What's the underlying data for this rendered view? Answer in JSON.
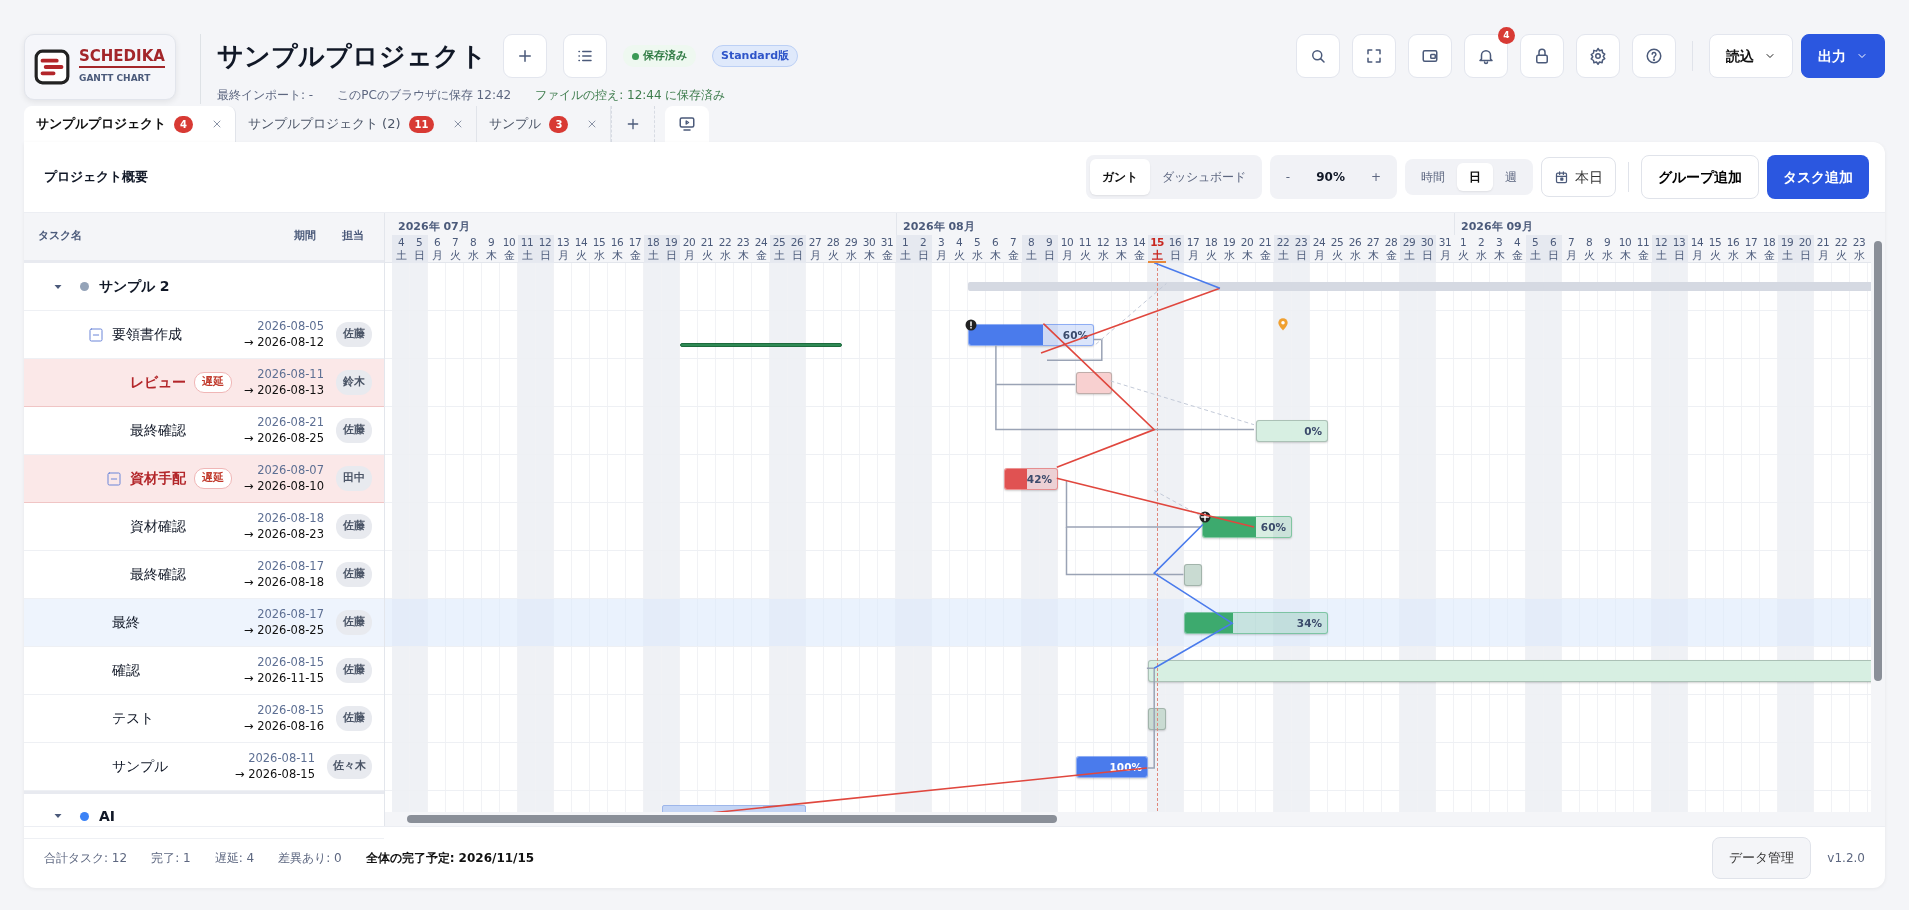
{
  "app": {
    "logo_title": "SCHEDIKA",
    "logo_subtitle": "GANTT CHART"
  },
  "project": {
    "title": "サンプルプロジェクト",
    "save_status": "保存済み",
    "edition": "Standard版"
  },
  "meta": [
    {
      "kind": "info",
      "text": "最終インポート: -"
    },
    {
      "kind": "info",
      "text": "このPCのブラウザに保存 12:42"
    },
    {
      "kind": "success",
      "text": "ファイルの控え: 12:44 に保存済み"
    }
  ],
  "toolbar_icons": [
    {
      "kind": "search"
    },
    {
      "kind": "fullscreen"
    },
    {
      "kind": "wallet"
    },
    {
      "kind": "bell",
      "badge": "4"
    },
    {
      "kind": "lock"
    },
    {
      "kind": "settings"
    },
    {
      "kind": "help"
    }
  ],
  "menus": [
    {
      "label": "読込",
      "primary": false
    },
    {
      "label": "出力",
      "primary": true
    }
  ],
  "tabs": [
    {
      "label": "サンプルプロジェクト",
      "count": "4",
      "selected": true
    },
    {
      "label": "サンプルプロジェクト (2)",
      "count": "11",
      "selected": false
    },
    {
      "label": "サンプル",
      "count": "3",
      "selected": false
    }
  ],
  "panel": {
    "title": "プロジェクト概要",
    "views": [
      {
        "label": "ガント",
        "selected": true
      },
      {
        "label": "ダッシュボード",
        "selected": false
      }
    ],
    "zoom": {
      "minus": "-",
      "value": "90%",
      "plus": "+"
    },
    "scales": [
      {
        "label": "時間",
        "selected": false
      },
      {
        "label": "日",
        "selected": true
      },
      {
        "label": "週",
        "selected": false
      }
    ],
    "today_button": "本日",
    "add_group": "グループ追加",
    "add_task": "タスク追加"
  },
  "columns": [
    "タスク名",
    "期間",
    "担当"
  ],
  "months": [
    {
      "label": "2026年 07月",
      "days": [
        {
          "day": "4",
          "weekday": "土",
          "weekend": true,
          "today": false
        },
        {
          "day": "5",
          "weekday": "日",
          "weekend": true,
          "today": false
        },
        {
          "day": "6",
          "weekday": "月",
          "weekend": false,
          "today": false
        },
        {
          "day": "7",
          "weekday": "火",
          "weekend": false,
          "today": false
        },
        {
          "day": "8",
          "weekday": "水",
          "weekend": false,
          "today": false
        },
        {
          "day": "9",
          "weekday": "木",
          "weekend": false,
          "today": false
        },
        {
          "day": "10",
          "weekday": "金",
          "weekend": false,
          "today": false
        },
        {
          "day": "11",
          "weekday": "土",
          "weekend": true,
          "today": false
        },
        {
          "day": "12",
          "weekday": "日",
          "weekend": true,
          "today": false
        },
        {
          "day": "13",
          "weekday": "月",
          "weekend": false,
          "today": false
        },
        {
          "day": "14",
          "weekday": "火",
          "weekend": false,
          "today": false
        },
        {
          "day": "15",
          "weekday": "水",
          "weekend": false,
          "today": false
        },
        {
          "day": "16",
          "weekday": "木",
          "weekend": false,
          "today": false
        },
        {
          "day": "17",
          "weekday": "金",
          "weekend": false,
          "today": false
        },
        {
          "day": "18",
          "weekday": "土",
          "weekend": true,
          "today": false
        },
        {
          "day": "19",
          "weekday": "日",
          "weekend": true,
          "today": false
        },
        {
          "day": "20",
          "weekday": "月",
          "weekend": false,
          "today": false
        },
        {
          "day": "21",
          "weekday": "火",
          "weekend": false,
          "today": false
        },
        {
          "day": "22",
          "weekday": "水",
          "weekend": false,
          "today": false
        },
        {
          "day": "23",
          "weekday": "木",
          "weekend": false,
          "today": false
        },
        {
          "day": "24",
          "weekday": "金",
          "weekend": false,
          "today": false
        },
        {
          "day": "25",
          "weekday": "土",
          "weekend": true,
          "today": false
        },
        {
          "day": "26",
          "weekday": "日",
          "weekend": true,
          "today": false
        },
        {
          "day": "27",
          "weekday": "月",
          "weekend": false,
          "today": false
        },
        {
          "day": "28",
          "weekday": "火",
          "weekend": false,
          "today": false
        },
        {
          "day": "29",
          "weekday": "水",
          "weekend": false,
          "today": false
        },
        {
          "day": "30",
          "weekday": "木",
          "weekend": false,
          "today": false
        },
        {
          "day": "31",
          "weekday": "金",
          "weekend": false,
          "today": false
        }
      ]
    },
    {
      "label": "2026年 08月",
      "days": [
        {
          "day": "1",
          "weekday": "土",
          "weekend": true,
          "today": false
        },
        {
          "day": "2",
          "weekday": "日",
          "weekend": true,
          "today": false
        },
        {
          "day": "3",
          "weekday": "月",
          "weekend": false,
          "today": false
        },
        {
          "day": "4",
          "weekday": "火",
          "weekend": false,
          "today": false
        },
        {
          "day": "5",
          "weekday": "水",
          "weekend": false,
          "today": false
        },
        {
          "day": "6",
          "weekday": "木",
          "weekend": false,
          "today": false
        },
        {
          "day": "7",
          "weekday": "金",
          "weekend": false,
          "today": false
        },
        {
          "day": "8",
          "weekday": "土",
          "weekend": true,
          "today": false
        },
        {
          "day": "9",
          "weekday": "日",
          "weekend": true,
          "today": false
        },
        {
          "day": "10",
          "weekday": "月",
          "weekend": false,
          "today": false
        },
        {
          "day": "11",
          "weekday": "火",
          "weekend": false,
          "today": false
        },
        {
          "day": "12",
          "weekday": "水",
          "weekend": false,
          "today": false
        },
        {
          "day": "13",
          "weekday": "木",
          "weekend": false,
          "today": false
        },
        {
          "day": "14",
          "weekday": "金",
          "weekend": false,
          "today": false
        },
        {
          "day": "15",
          "weekday": "土",
          "weekend": true,
          "today": true
        },
        {
          "day": "16",
          "weekday": "日",
          "weekend": true,
          "today": false
        },
        {
          "day": "17",
          "weekday": "月",
          "weekend": false,
          "today": false
        },
        {
          "day": "18",
          "weekday": "火",
          "weekend": false,
          "today": false
        },
        {
          "day": "19",
          "weekday": "水",
          "weekend": false,
          "today": false
        },
        {
          "day": "20",
          "weekday": "木",
          "weekend": false,
          "today": false
        },
        {
          "day": "21",
          "weekday": "金",
          "weekend": false,
          "today": false
        },
        {
          "day": "22",
          "weekday": "土",
          "weekend": true,
          "today": false
        },
        {
          "day": "23",
          "weekday": "日",
          "weekend": true,
          "today": false
        },
        {
          "day": "24",
          "weekday": "月",
          "weekend": false,
          "today": false
        },
        {
          "day": "25",
          "weekday": "火",
          "weekend": false,
          "today": false
        },
        {
          "day": "26",
          "weekday": "水",
          "weekend": false,
          "today": false
        },
        {
          "day": "27",
          "weekday": "木",
          "weekend": false,
          "today": false
        },
        {
          "day": "28",
          "weekday": "金",
          "weekend": false,
          "today": false
        },
        {
          "day": "29",
          "weekday": "土",
          "weekend": true,
          "today": false
        },
        {
          "day": "30",
          "weekday": "日",
          "weekend": true,
          "today": false
        },
        {
          "day": "31",
          "weekday": "月",
          "weekend": false,
          "today": false
        }
      ]
    },
    {
      "label": "2026年 09月",
      "days": [
        {
          "day": "1",
          "weekday": "火",
          "weekend": false,
          "today": false
        },
        {
          "day": "2",
          "weekday": "水",
          "weekend": false,
          "today": false
        },
        {
          "day": "3",
          "weekday": "木",
          "weekend": false,
          "today": false
        },
        {
          "day": "4",
          "weekday": "金",
          "weekend": false,
          "today": false
        },
        {
          "day": "5",
          "weekday": "土",
          "weekend": true,
          "today": false
        },
        {
          "day": "6",
          "weekday": "日",
          "weekend": true,
          "today": false
        },
        {
          "day": "7",
          "weekday": "月",
          "weekend": false,
          "today": false
        },
        {
          "day": "8",
          "weekday": "火",
          "weekend": false,
          "today": false
        },
        {
          "day": "9",
          "weekday": "水",
          "weekend": false,
          "today": false
        },
        {
          "day": "10",
          "weekday": "木",
          "weekend": false,
          "today": false
        },
        {
          "day": "11",
          "weekday": "金",
          "weekend": false,
          "today": false
        },
        {
          "day": "12",
          "weekday": "土",
          "weekend": true,
          "today": false
        },
        {
          "day": "13",
          "weekday": "日",
          "weekend": true,
          "today": false
        },
        {
          "day": "14",
          "weekday": "月",
          "weekend": false,
          "today": false
        },
        {
          "day": "15",
          "weekday": "火",
          "weekend": false,
          "today": false
        },
        {
          "day": "16",
          "weekday": "水",
          "weekend": false,
          "today": false
        },
        {
          "day": "17",
          "weekday": "木",
          "weekend": false,
          "today": false
        },
        {
          "day": "18",
          "weekday": "金",
          "weekend": false,
          "today": false
        },
        {
          "day": "19",
          "weekday": "土",
          "weekend": true,
          "today": false
        },
        {
          "day": "20",
          "weekday": "日",
          "weekend": true,
          "today": false
        },
        {
          "day": "21",
          "weekday": "月",
          "weekend": false,
          "today": false
        },
        {
          "day": "22",
          "weekday": "火",
          "weekend": false,
          "today": false
        },
        {
          "day": "23",
          "weekday": "水",
          "weekend": false,
          "today": false
        }
      ]
    }
  ],
  "groups": [
    {
      "name": "サンプル 2",
      "color": "#94a3b8",
      "expanded": true,
      "tasks": [
        {
          "name": "要領書作成",
          "start": "2026-08-05",
          "end": "→ 2026-08-12",
          "assignee": "佐藤",
          "delayed": false,
          "selected": false,
          "expanded": true,
          "level": 0.6,
          "progress_label": "60%",
          "color": "#4a7bec",
          "warning": true,
          "baseline": true,
          "pin": true,
          "children": [
            {
              "name": "レビュー",
              "start": "2026-08-11",
              "end": "→ 2026-08-13",
              "assignee": "鈴木",
              "delayed": true,
              "delay_label": "遅延",
              "selected": false,
              "color": "#f8d0d0"
            },
            {
              "name": "最終確認",
              "start": "2026-08-21",
              "end": "→ 2026-08-25",
              "assignee": "佐藤",
              "delayed": false,
              "selected": false,
              "progress_label": "0%",
              "color": "#d7efe2"
            },
            {
              "name": "資材手配",
              "start": "2026-08-07",
              "end": "→ 2026-08-10",
              "assignee": "田中",
              "delayed": true,
              "delay_label": "遅延",
              "selected": false,
              "expanded": true,
              "level": 0.42,
              "progress_label": "42%",
              "color": "#e05252",
              "children": [
                {
                  "name": "資材確認",
                  "start": "2026-08-18",
                  "end": "→ 2026-08-23",
                  "assignee": "佐藤",
                  "delayed": false,
                  "selected": false,
                  "level": 0.6,
                  "progress_label": "60%",
                  "color": "#3daa6e",
                  "move_handle": true
                },
                {
                  "name": "最終確認",
                  "start": "2026-08-17",
                  "end": "→ 2026-08-18",
                  "assignee": "佐藤",
                  "delayed": false,
                  "selected": false,
                  "color": "#c9dbd2"
                }
              ]
            }
          ]
        },
        {
          "name": "最終",
          "start": "2026-08-17",
          "end": "→ 2026-08-25",
          "assignee": "佐藤",
          "delayed": false,
          "selected": true,
          "level": 0.34,
          "progress_label": "34%",
          "color": "#3daa6e"
        },
        {
          "name": "確認",
          "start": "2026-08-15",
          "end": "→ 2026-11-15",
          "assignee": "佐藤",
          "delayed": false,
          "selected": false,
          "color": "#d7efe2"
        },
        {
          "name": "テスト",
          "start": "2026-08-15",
          "end": "→ 2026-08-16",
          "assignee": "佐藤",
          "delayed": false,
          "selected": false,
          "color": "#c9dbd2"
        },
        {
          "name": "サンプル",
          "start": "2026-08-11",
          "end": "→ 2026-08-15",
          "assignee": "佐々木",
          "delayed": false,
          "selected": false,
          "level": 1,
          "progress_label": "100%",
          "color": "#4a7bec"
        }
      ]
    },
    {
      "name": "AI",
      "color": "#3b82f6",
      "expanded": true
    }
  ],
  "footer": {
    "stats": [
      "合計タスク: 12",
      "完了: 1",
      "遅延: 4",
      "差異あり: 0"
    ],
    "completion": "全体の完了予定: 2026/11/15",
    "data_button": "データ管理",
    "version": "v1.2.0"
  }
}
